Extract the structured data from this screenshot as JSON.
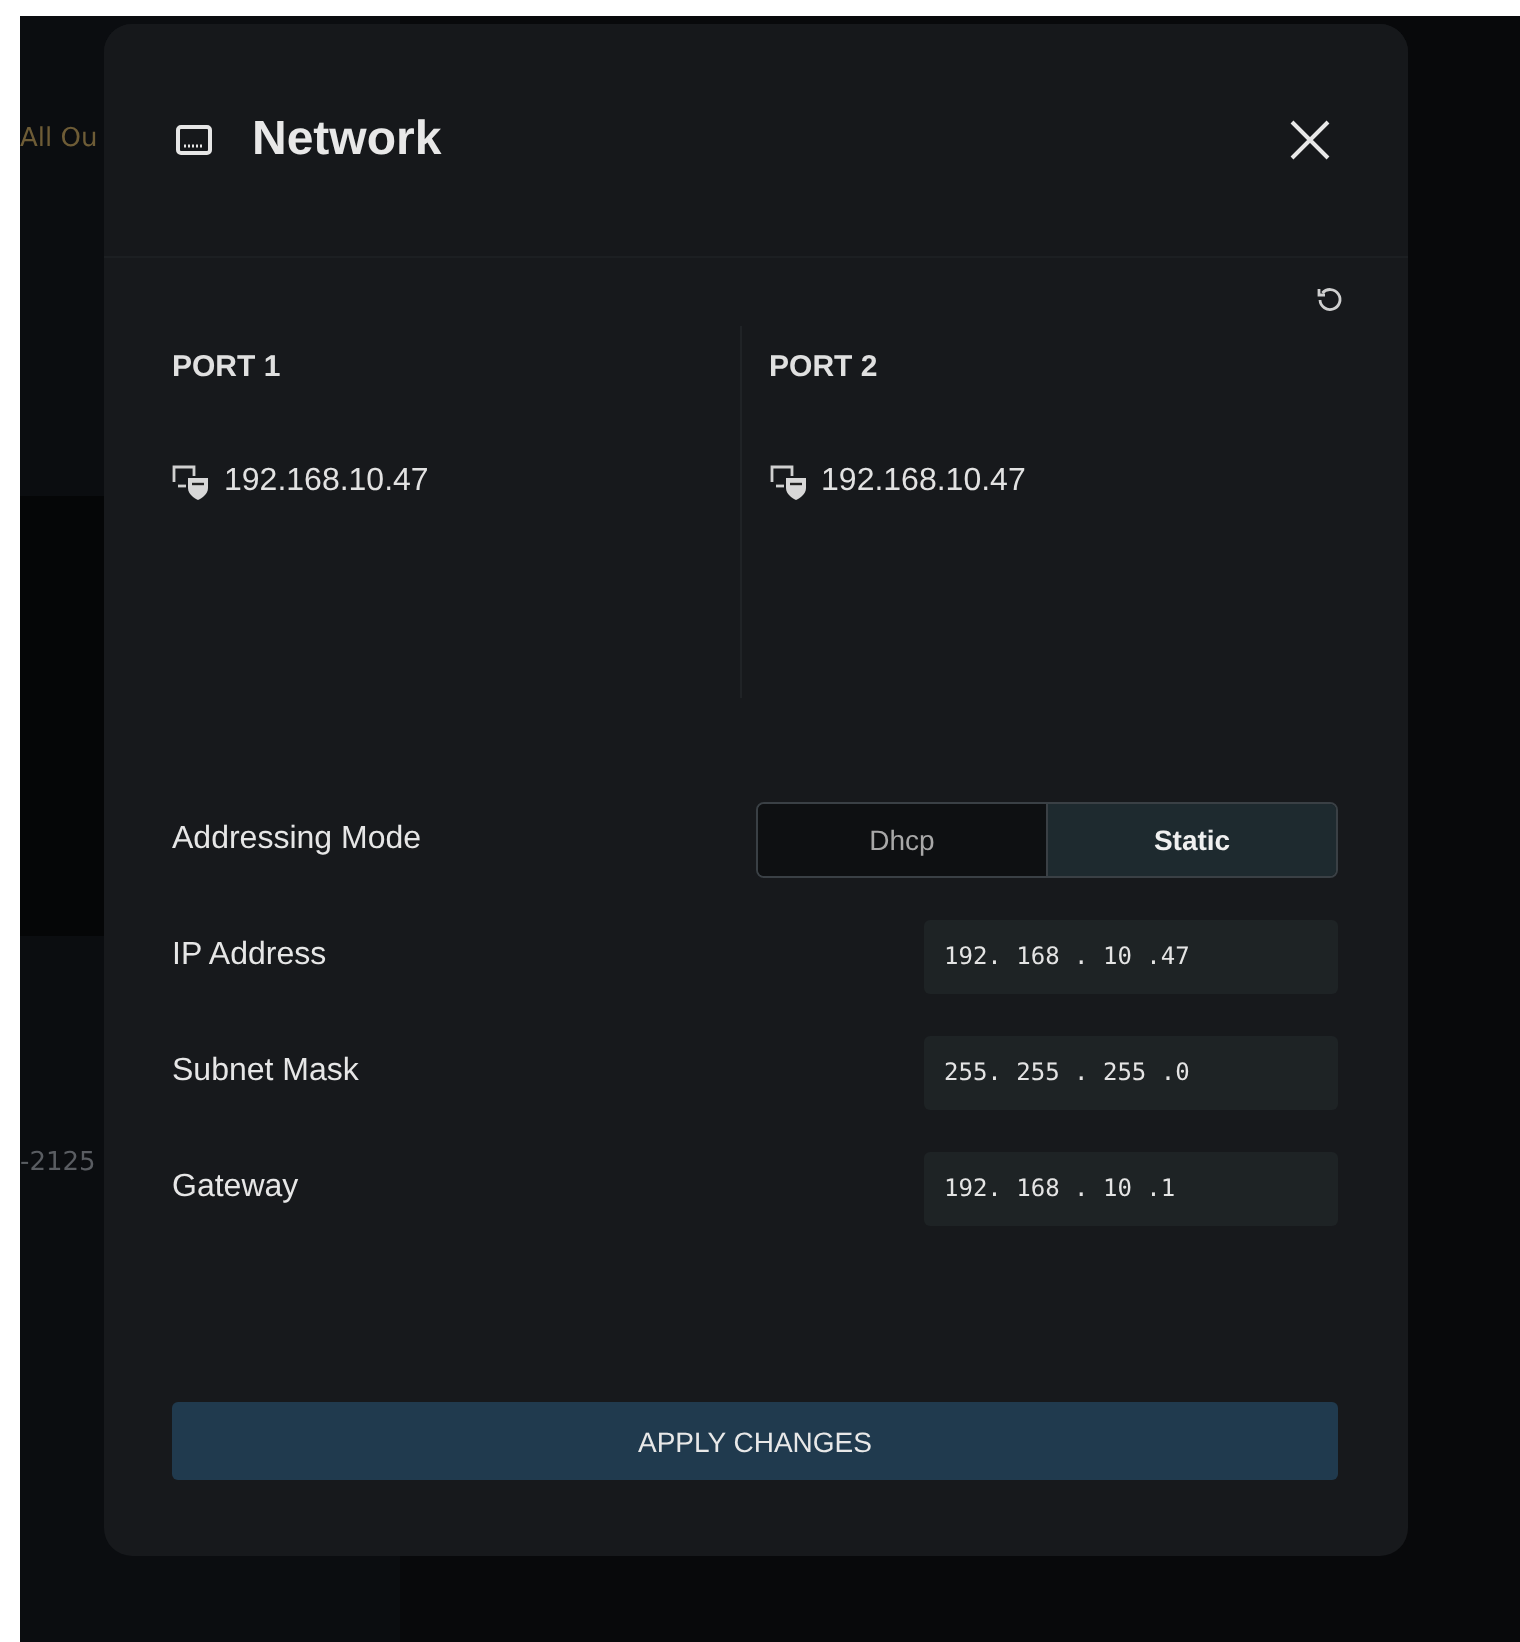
{
  "background": {
    "texts": [
      {
        "text": "All Ou",
        "kind": "accent"
      },
      {
        "text": "-2125",
        "kind": "muted"
      }
    ]
  },
  "dialog": {
    "title": "Network",
    "ports": [
      {
        "label": "PORT 1",
        "address": "192.168.10.47"
      },
      {
        "label": "PORT 2",
        "address": "192.168.10.47"
      }
    ],
    "addressing_mode": {
      "label": "Addressing Mode",
      "options": [
        {
          "label": "Dhcp",
          "selected": false
        },
        {
          "label": "Static",
          "selected": true
        }
      ]
    },
    "fields": [
      {
        "label": "IP Address",
        "value": "192. 168 . 10 .47"
      },
      {
        "label": "Subnet Mask",
        "value": "255. 255 . 255 .0"
      },
      {
        "label": "Gateway",
        "value": "192. 168 . 10 .1"
      }
    ],
    "apply_button": "APPLY CHANGES"
  }
}
